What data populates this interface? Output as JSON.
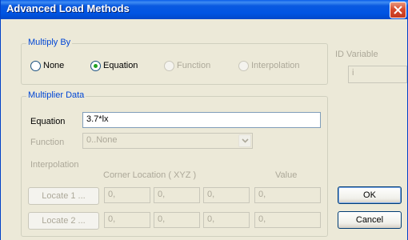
{
  "window": {
    "title": "Advanced Load Methods"
  },
  "multiply_by": {
    "legend": "Multiply By",
    "options": [
      {
        "label": "None",
        "selected": false,
        "enabled": true
      },
      {
        "label": "Equation",
        "selected": true,
        "enabled": true
      },
      {
        "label": "Function",
        "selected": false,
        "enabled": false
      },
      {
        "label": "Interpolation",
        "selected": false,
        "enabled": false
      }
    ]
  },
  "id_variable": {
    "label": "ID Variable",
    "value": "i"
  },
  "multiplier_data": {
    "legend": "Multiplier Data",
    "equation_label": "Equation",
    "equation_value": "3.7*lx",
    "function_label": "Function",
    "function_value": "0..None",
    "interpolation_label": "Interpolation",
    "corner_location_header": "Corner Location ( XYZ )",
    "value_header": "Value",
    "rows": [
      {
        "button": "Locate 1 ...",
        "x": "0,",
        "y": "0,",
        "z": "0,",
        "value": "0,"
      },
      {
        "button": "Locate 2 ...",
        "x": "0,",
        "y": "0,",
        "z": "0,",
        "value": "0,"
      }
    ]
  },
  "buttons": {
    "ok": "OK",
    "cancel": "Cancel"
  },
  "colors": {
    "titlebar": "#0054e3",
    "dialog_bg": "#ece9d8",
    "group_label": "#0046d5",
    "disabled_text": "#aca899",
    "close": "#d84b2d"
  }
}
